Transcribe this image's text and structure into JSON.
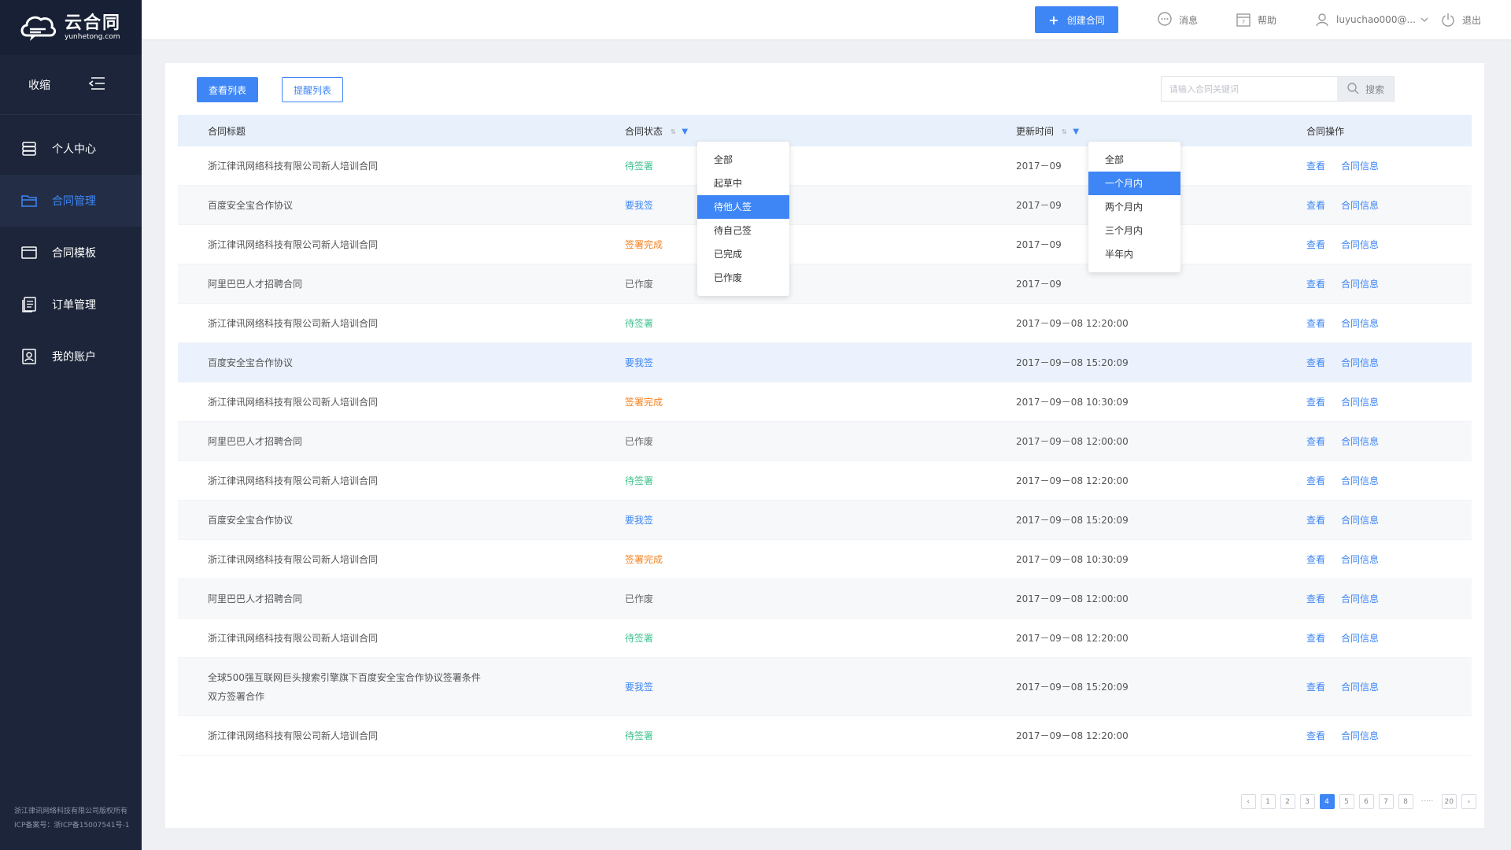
{
  "brand": {
    "title": "云合同",
    "subtitle": "yunhetong.com"
  },
  "sidebar": {
    "collapse_label": "收缩",
    "items": [
      {
        "label": "个人中心",
        "icon": "database-icon"
      },
      {
        "label": "合同管理",
        "icon": "folder-icon",
        "active": true
      },
      {
        "label": "合同模板",
        "icon": "template-icon"
      },
      {
        "label": "订单管理",
        "icon": "document-icon"
      },
      {
        "label": "我的账户",
        "icon": "user-card-icon"
      }
    ],
    "copyright": [
      "浙江律讯网络科技有限公司版权所有",
      "ICP备案号：浙ICP备15007541号-1"
    ]
  },
  "topbar": {
    "create_label": "创建合同",
    "message_label": "消息",
    "help_label": "帮助",
    "user_label": "luyuchao000@...",
    "logout_label": "退出"
  },
  "toolbar": {
    "view_list_label": "查看列表",
    "remind_list_label": "提醒列表",
    "search_placeholder": "请输入合同关键词",
    "search_label": "搜索"
  },
  "table": {
    "headers": {
      "title": "合同标题",
      "status": "合同状态",
      "updated": "更新时间",
      "ops": "合同操作"
    },
    "view_label": "查看",
    "info_label": "合同信息",
    "rows": [
      {
        "title": "浙江律讯网络科技有限公司新人培训合同",
        "status": "待签署",
        "tone": "green",
        "time": "2017－09"
      },
      {
        "title": "百度安全宝合作协议",
        "status": "要我签",
        "tone": "blue",
        "time": "2017－09"
      },
      {
        "title": "浙江律讯网络科技有限公司新人培训合同",
        "status": "签署完成",
        "tone": "orange",
        "time": "2017－09"
      },
      {
        "title": "阿里巴巴人才招聘合同",
        "status": "已作废",
        "tone": "gray",
        "time": "2017－09"
      },
      {
        "title": "浙江律讯网络科技有限公司新人培训合同",
        "status": "待签署",
        "tone": "green",
        "time": "2017－09－08   12:20:00"
      },
      {
        "title": "百度安全宝合作协议",
        "status": "要我签",
        "tone": "blue",
        "time": "2017－09－08   15:20:09"
      },
      {
        "title": "浙江律讯网络科技有限公司新人培训合同",
        "status": "签署完成",
        "tone": "orange",
        "time": "2017－09－08   10:30:09"
      },
      {
        "title": "阿里巴巴人才招聘合同",
        "status": "已作废",
        "tone": "gray",
        "time": "2017－09－08   12:00:00"
      },
      {
        "title": "浙江律讯网络科技有限公司新人培训合同",
        "status": "待签署",
        "tone": "green",
        "time": "2017－09－08   12:20:00"
      },
      {
        "title": "百度安全宝合作协议",
        "status": "要我签",
        "tone": "blue",
        "time": "2017－09－08   15:20:09"
      },
      {
        "title": "浙江律讯网络科技有限公司新人培训合同",
        "status": "签署完成",
        "tone": "orange",
        "time": "2017－09－08   10:30:09"
      },
      {
        "title": "阿里巴巴人才招聘合同",
        "status": "已作废",
        "tone": "gray",
        "time": "2017－09－08   12:00:00"
      },
      {
        "title": "浙江律讯网络科技有限公司新人培训合同",
        "status": "待签署",
        "tone": "green",
        "time": "2017－09－08   12:20:00"
      },
      {
        "title": "全球500强互联网巨头搜索引擎旗下百度安全宝合作协议签署条件\n双方签署合作",
        "status": "要我签",
        "tone": "blue",
        "time": "2017－09－08   15:20:09"
      },
      {
        "title": "浙江律讯网络科技有限公司新人培训合同",
        "status": "待签署",
        "tone": "green",
        "time": "2017－09－08   12:20:00"
      }
    ]
  },
  "status_filter": {
    "options": [
      "全部",
      "起草中",
      "待他人签",
      "待自己签",
      "已完成",
      "已作废"
    ],
    "selected": "待他人签"
  },
  "time_filter": {
    "options": [
      "全部",
      "一个月内",
      "两个月内",
      "三个月内",
      "半年内"
    ],
    "selected": "一个月内"
  },
  "pagination": {
    "pages": [
      "1",
      "2",
      "3",
      "4",
      "5",
      "6",
      "7",
      "8",
      "20"
    ],
    "current": "4",
    "ellipsis": "·····"
  },
  "colors": {
    "accent": "#3e86f5",
    "green": "#41c28f",
    "orange": "#f6821f",
    "sidebar": "#1c2539"
  }
}
